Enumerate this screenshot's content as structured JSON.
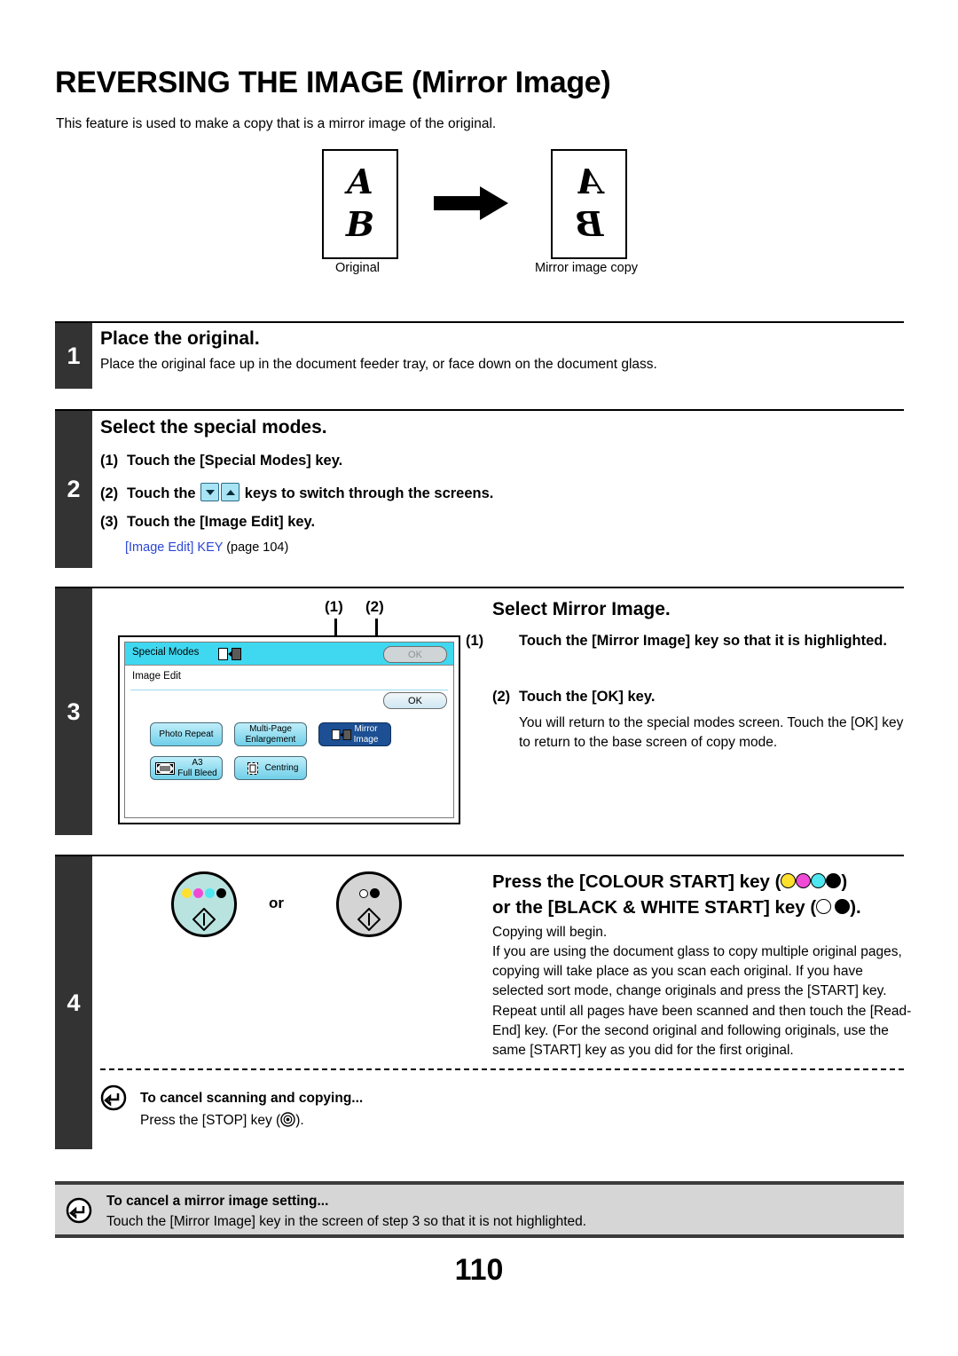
{
  "document": {
    "title": "REVERSING THE IMAGE (Mirror Image)",
    "intro": "This feature is used to make a copy that is a mirror image of the original.",
    "page_number": "110"
  },
  "illustration": {
    "original_caption": "Original",
    "copy_caption": "Mirror image copy",
    "glyph_top": "A",
    "glyph_bottom": "B",
    "arrow_icon": "right-arrow-icon"
  },
  "steps": [
    {
      "number": "1",
      "heading": "Place the original.",
      "body": "Place the original face up in the document feeder tray, or face down on the document glass."
    },
    {
      "number": "2",
      "heading": "Select the special modes.",
      "substeps": [
        {
          "index": "(1)",
          "text_before": "Touch the [Special Modes] key.",
          "text_after": ""
        },
        {
          "index": "(2)",
          "text_before": "Touch the",
          "text_after": "keys to switch through the screens."
        },
        {
          "index": "(3)",
          "text_before": "Touch the [Image Edit] key.",
          "text_after": ""
        }
      ],
      "reference_link": "[Image Edit] KEY",
      "reference_page": "(page 104)"
    },
    {
      "number": "3",
      "heading": "Select Mirror Image.",
      "substeps": [
        {
          "index": "(1)",
          "text": "Touch the [Mirror Image] key so that it is highlighted."
        },
        {
          "index": "(2)",
          "text": "Touch the [OK] key."
        }
      ],
      "body": "You will return to the special modes screen. Touch the [OK] key to return to the base screen of copy mode.",
      "callouts": [
        "(1)",
        "(2)"
      ]
    },
    {
      "number": "4",
      "heading_line1_prefix": "Press the [COLOUR START] key (",
      "heading_line1_suffix": ")",
      "heading_line2_prefix": "or the [BLACK & WHITE START] key (",
      "heading_line2_suffix": ").",
      "body": "Copying will begin.\nIf you are using the document glass to copy multiple original pages, copying will take place as you scan each original. If you have selected sort mode, change originals and press the [START] key. Repeat until all pages have been scanned and then touch the [Read-End] key. (For the second original and following originals, use the same [START] key as you did for the first original.",
      "or_label": "or"
    }
  ],
  "touch_panel": {
    "special_modes_label": "Special Modes",
    "special_modes_icon": "mirror-image-icon",
    "image_edit_label": "Image Edit",
    "ok_disabled_label": "OK",
    "ok_active_label": "OK",
    "buttons": [
      {
        "label": "Photo Repeat",
        "selected": false,
        "icon": ""
      },
      {
        "label": "Multi-Page\nEnlargement",
        "selected": false,
        "icon": ""
      },
      {
        "label": "Mirror\nImage",
        "selected": true,
        "icon": "mirror-image-icon"
      },
      {
        "label": "A3\nFull Bleed",
        "selected": false,
        "icon": "full-bleed-icon"
      },
      {
        "label": "Centring",
        "selected": false,
        "icon": "centring-icon"
      }
    ]
  },
  "notes": [
    {
      "icon": "cancel-return-icon",
      "title": "To cancel scanning and copying...",
      "body_prefix": "Press the [STOP] key (",
      "body_suffix": ").",
      "stop_icon": "stop-key-icon"
    },
    {
      "icon": "cancel-return-icon",
      "title": "To cancel a mirror image setting...",
      "body": "Touch the [Mirror Image] key in the screen of step 3 so that it is not highlighted."
    }
  ],
  "colors": {
    "panel_header": "#3fd8f0",
    "panel_button": "#6fcfe8",
    "panel_selected": "#1c4f93",
    "step_number_bg": "#333333",
    "link": "#2b46d6",
    "note_bg": "#d6d6d6",
    "colour_start_bg": "#b9e3df",
    "bw_start_bg": "#d4d4d4"
  }
}
